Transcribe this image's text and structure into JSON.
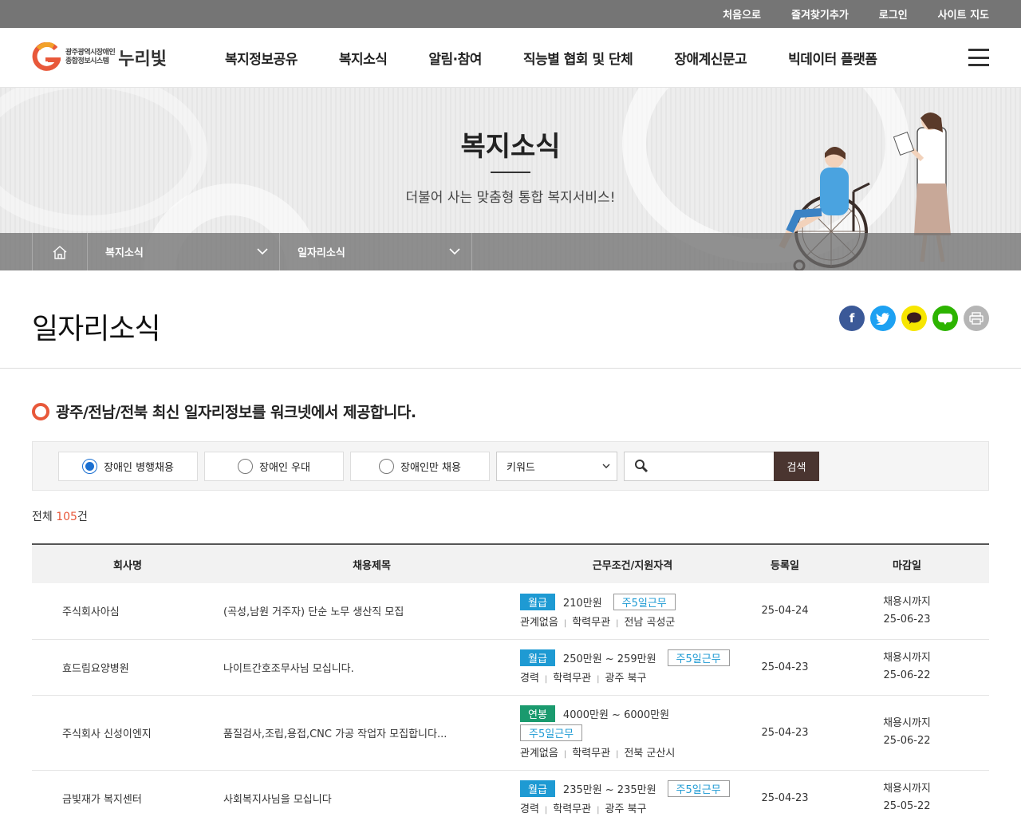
{
  "topbar": {
    "items": [
      "처음으로",
      "즐겨찾기추가",
      "로그인",
      "사이트 지도"
    ]
  },
  "logo": {
    "sub1": "광주광역시장애인",
    "sub2": "종합정보시스템",
    "name": "누리빛"
  },
  "gnb": [
    "복지정보공유",
    "복지소식",
    "알림·참여",
    "직능별 협회 및 단체",
    "장애계신문고",
    "빅데이터 플랫폼"
  ],
  "hero": {
    "title": "복지소식",
    "subtitle": "더불어 사는 맞춤형 통합 복지서비스!"
  },
  "breadcrumb": {
    "level1": "복지소식",
    "level2": "일자리소식"
  },
  "page": {
    "title": "일자리소식"
  },
  "share": [
    "facebook",
    "twitter",
    "kakaotalk",
    "blog",
    "print"
  ],
  "colors": {
    "accent": "#e8583a",
    "pay_month": "#1e9ad3",
    "pay_year": "#1a9a6e",
    "search_btn": "#4a3530"
  },
  "section": {
    "heading": "광주/전남/전북 최신 일자리정보를 워크넷에서 제공합니다."
  },
  "search": {
    "options": [
      "장애인 병행채용",
      "장애인 우대",
      "장애인만 채용"
    ],
    "selected": "장애인 병행채용",
    "select_value": "키워드",
    "button": "검색"
  },
  "total": {
    "prefix": "전체 ",
    "count": "105",
    "suffix": "건"
  },
  "table": {
    "headers": [
      "회사명",
      "채용제목",
      "근무조건/지원자격",
      "등록일",
      "마감일"
    ],
    "rows": [
      {
        "company": "주식회사아심",
        "title": "(곡성,남원 거주자) 단순 노무 생산직 모집",
        "pay_type": "월급",
        "salary": "210만원",
        "work": "주5일근무",
        "career": "관계없음",
        "edu": "학력무관",
        "region": "전남 곡성군",
        "reg": "25-04-24",
        "deadline1": "채용시까지",
        "deadline2": "25-06-23"
      },
      {
        "company": "효드림요양병원",
        "title": "나이트간호조무사님 모십니다.",
        "pay_type": "월급",
        "salary": "250만원 ~ 259만원",
        "work": "주5일근무",
        "career": "경력",
        "edu": "학력무관",
        "region": "광주 북구",
        "reg": "25-04-23",
        "deadline1": "채용시까지",
        "deadline2": "25-06-22"
      },
      {
        "company": "주식회사 신성이엔지",
        "title": "품질검사,조립,용접,CNC 가공 작업자 모집합니다...",
        "pay_type": "연봉",
        "salary": "4000만원 ~ 6000만원",
        "work": "주5일근무",
        "career": "관계없음",
        "edu": "학력무관",
        "region": "전북 군산시",
        "reg": "25-04-23",
        "deadline1": "채용시까지",
        "deadline2": "25-06-22"
      },
      {
        "company": "금빛재가 복지센터",
        "title": "사회복지사님을 모십니다",
        "pay_type": "월급",
        "salary": "235만원 ~ 235만원",
        "work": "주5일근무",
        "career": "경력",
        "edu": "학력무관",
        "region": "광주 북구",
        "reg": "25-04-23",
        "deadline1": "채용시까지",
        "deadline2": "25-05-22"
      }
    ]
  }
}
